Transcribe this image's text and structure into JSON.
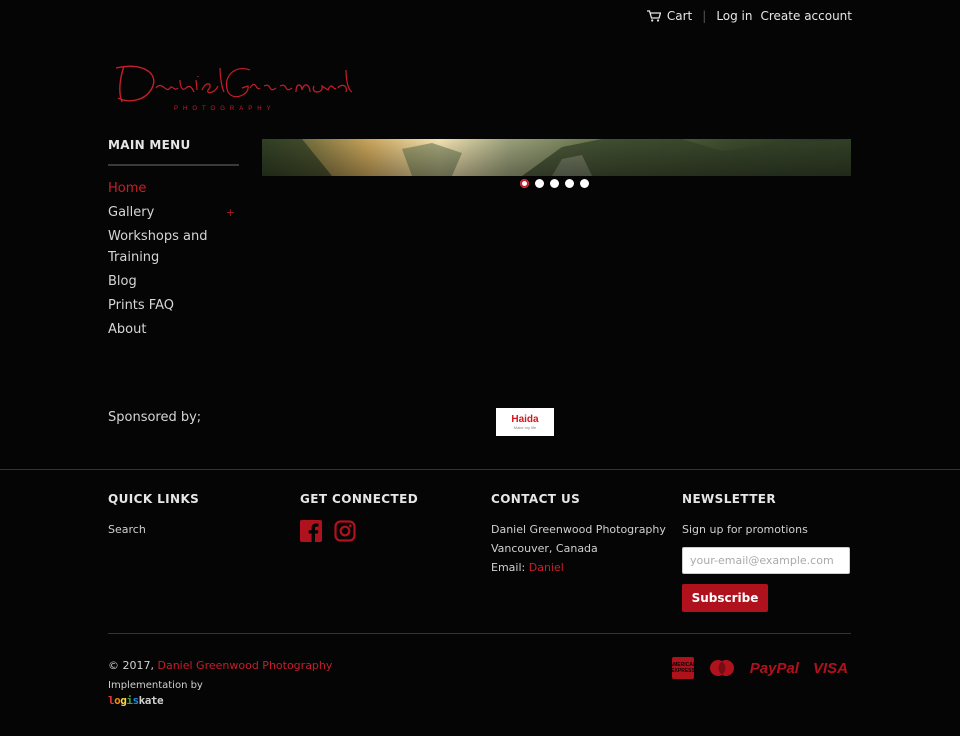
{
  "header": {
    "cart_label": "Cart",
    "separator": "|",
    "login_label": "Log in",
    "create_account_label": "Create account"
  },
  "logo": {
    "script_text": "Daniel Greenwood",
    "subtitle": "PHOTOGRAPHY"
  },
  "menu": {
    "title": "MAIN MENU",
    "items": [
      {
        "label": "Home"
      },
      {
        "label": "Gallery",
        "expand": "+"
      },
      {
        "label": "Workshops and Training"
      },
      {
        "label": "Blog"
      },
      {
        "label": "Prints FAQ"
      },
      {
        "label": "About"
      }
    ]
  },
  "slider": {
    "slide_count": 5,
    "active_index": 0
  },
  "sponsor": {
    "label": "Sponsored by;",
    "brand": "Haida",
    "brand_sub": "Make my life"
  },
  "footer": {
    "quick_links": {
      "title": "QUICK LINKS",
      "search": "Search"
    },
    "get_connected": {
      "title": "GET CONNECTED",
      "icons": [
        "facebook-icon",
        "instagram-icon"
      ]
    },
    "contact": {
      "title": "CONTACT US",
      "line1": "Daniel Greenwood Photography",
      "line2": "Vancouver, Canada",
      "email_label": "Email:",
      "email_link": "Daniel"
    },
    "newsletter": {
      "title": "NEWSLETTER",
      "text": "Sign up for promotions",
      "placeholder": "your-email@example.com",
      "button": "Subscribe"
    },
    "copyright_prefix": "© 2017,",
    "copyright_link": "Daniel Greenwood Photography",
    "implementation": "Implementation by",
    "implementer": "logiskate",
    "payments": [
      "American Express",
      "Master",
      "PayPal",
      "VISA"
    ]
  },
  "colors": {
    "background": "#050505",
    "accent": "#c81d2a",
    "button": "#b0121d"
  }
}
